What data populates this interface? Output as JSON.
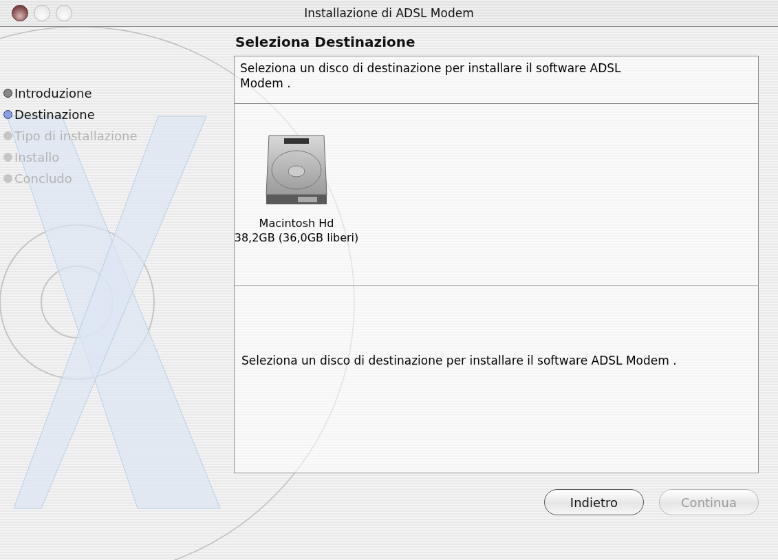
{
  "window": {
    "title": "Installazione di ADSL Modem"
  },
  "steps": [
    {
      "label": "Introduzione",
      "completed": true,
      "selected": false
    },
    {
      "label": "Destinazione",
      "completed": false,
      "selected": true
    },
    {
      "label": "Tipo di installazione",
      "completed": false,
      "selected": false
    },
    {
      "label": "Installo",
      "completed": false,
      "selected": false
    },
    {
      "label": "Concludo",
      "completed": false,
      "selected": false
    }
  ],
  "heading": "Seleziona Destinazione",
  "prompt": "Seleziona un disco di destinazione per installare il software ADSL Modem .",
  "disks": [
    {
      "name": "Macintosh Hd",
      "size": "38,2GB (36,0GB liberi)"
    }
  ],
  "description": "Seleziona un disco di destinazione per installare il software ADSL Modem .",
  "buttons": [
    {
      "label": "Indietro",
      "disabled": false
    },
    {
      "label": "Continua",
      "disabled": true
    }
  ]
}
